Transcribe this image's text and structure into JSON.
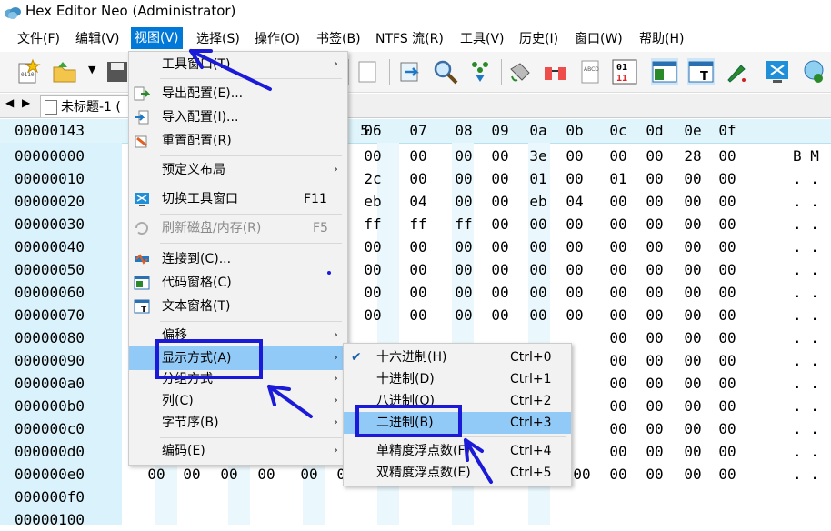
{
  "window": {
    "title": "Hex Editor Neo (Administrator)"
  },
  "menubar": {
    "items": [
      "文件(F)",
      "编辑(V)",
      "视图(V)",
      "选择(S)",
      "操作(O)",
      "书签(B)",
      "NTFS 流(R)",
      "工具(V)",
      "历史(I)",
      "窗口(W)",
      "帮助(H)"
    ]
  },
  "tabs": {
    "doc_label": "未标题-1 ("
  },
  "hex": {
    "current_offset": "00000143",
    "columns": [
      "06",
      "07",
      "08",
      "09",
      "0a",
      "0b",
      "0c",
      "0d",
      "0e",
      "0f"
    ],
    "col5_partial": "5",
    "offsets": [
      "00000000",
      "00000010",
      "00000020",
      "00000030",
      "00000040",
      "00000050",
      "00000060",
      "00000070",
      "00000080",
      "00000090",
      "000000a0",
      "000000b0",
      "000000c0",
      "000000d0",
      "000000e0",
      "000000f0",
      "00000100"
    ],
    "rows": [
      [
        "00",
        "00",
        "00",
        "00",
        "3e",
        "00",
        "00",
        "00",
        "28",
        "00"
      ],
      [
        "2c",
        "00",
        "00",
        "00",
        "01",
        "00",
        "01",
        "00",
        "00",
        "00"
      ],
      [
        "eb",
        "04",
        "00",
        "00",
        "eb",
        "04",
        "00",
        "00",
        "00",
        "00"
      ],
      [
        "ff",
        "ff",
        "ff",
        "00",
        "00",
        "00",
        "00",
        "00",
        "00",
        "00"
      ],
      [
        "00",
        "00",
        "00",
        "00",
        "00",
        "00",
        "00",
        "00",
        "00",
        "00"
      ],
      [
        "00",
        "00",
        "00",
        "00",
        "00",
        "00",
        "00",
        "00",
        "00",
        "00"
      ],
      [
        "00",
        "00",
        "00",
        "00",
        "00",
        "00",
        "00",
        "00",
        "00",
        "00"
      ],
      [
        "00",
        "00",
        "00",
        "00",
        "00",
        "00",
        "00",
        "00",
        "00",
        "00"
      ]
    ],
    "row_e0": [
      "00",
      "00",
      "00",
      "00",
      "00",
      "00",
      "00",
      "00",
      "00",
      "00",
      "00",
      "00",
      "00",
      "00",
      "00",
      "00"
    ],
    "partial_first_col": [
      "0",
      "0",
      "0",
      "0",
      "0",
      "0",
      "0",
      "0"
    ],
    "right_col_rows": [
      "00",
      "00",
      "00",
      "00",
      "00",
      "00",
      "00",
      "00",
      "00",
      "00"
    ],
    "ascii_rows": [
      "B M",
      ". .",
      ". .",
      ". .",
      ". .",
      ". .",
      ". .",
      ". .",
      ". .",
      ". .",
      ". .",
      ". .",
      ". .",
      ". .",
      ". ."
    ]
  },
  "view_menu": {
    "items": [
      {
        "label": "工具窗口(T)",
        "submenu": true
      },
      {
        "label": "导出配置(E)..."
      },
      {
        "label": "导入配置(I)..."
      },
      {
        "label": "重置配置(R)"
      },
      {
        "label": "预定义布局",
        "submenu": true
      },
      {
        "label": "切换工具窗口",
        "shortcut": "F11"
      },
      {
        "label": "刷新磁盘/内存(R)",
        "shortcut": "F5",
        "disabled": true
      },
      {
        "label": "连接到(C)..."
      },
      {
        "label": "代码窗格(C)"
      },
      {
        "label": "文本窗格(T)"
      },
      {
        "label": "偏移",
        "submenu": true
      },
      {
        "label": "显示方式(A)",
        "submenu": true,
        "highlighted": true
      },
      {
        "label": "分组方式",
        "submenu": true
      },
      {
        "label": "列(C)",
        "submenu": true
      },
      {
        "label": "字节序(B)",
        "submenu": true
      },
      {
        "label": "编码(E)",
        "submenu": true
      }
    ]
  },
  "display_submenu": {
    "items": [
      {
        "label": "十六进制(H)",
        "shortcut": "Ctrl+0",
        "checked": true
      },
      {
        "label": "十进制(D)",
        "shortcut": "Ctrl+1"
      },
      {
        "label": "八进制(O)",
        "shortcut": "Ctrl+2"
      },
      {
        "label": "二进制(B)",
        "shortcut": "Ctrl+3",
        "highlighted": true
      },
      {
        "label": "单精度浮点数(F)",
        "shortcut": "Ctrl+4"
      },
      {
        "label": "双精度浮点数(E)",
        "shortcut": "Ctrl+5"
      }
    ]
  },
  "colors": {
    "accent": "#0078d7",
    "highlight": "#91c9f7",
    "annotation": "#1a1ad8",
    "hex_bg": "#d9f2fb"
  }
}
